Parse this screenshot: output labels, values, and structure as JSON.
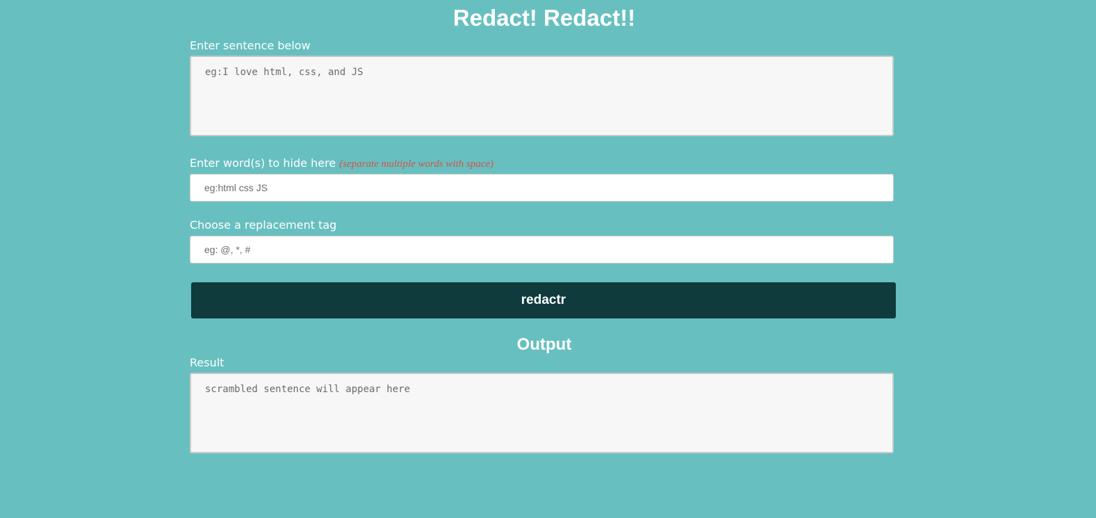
{
  "header": {
    "title": "Redact! Redact!!"
  },
  "sentence": {
    "label": "Enter sentence below",
    "placeholder": "eg:I love html, css, and JS",
    "value": ""
  },
  "words": {
    "label": "Enter word(s) to hide here",
    "hint": "(separate multiple words with space)",
    "placeholder": "eg:html css JS",
    "value": ""
  },
  "replacement": {
    "label": "Choose a replacement tag",
    "placeholder": "eg: @, *, #",
    "value": ""
  },
  "action": {
    "button_label": "redactr"
  },
  "output": {
    "heading": "Output",
    "result_label": "Result",
    "placeholder": "scrambled sentence will appear here",
    "value": ""
  },
  "colors": {
    "background": "#68bfc0",
    "button": "#0f3b3d",
    "hint": "#d2544a"
  }
}
